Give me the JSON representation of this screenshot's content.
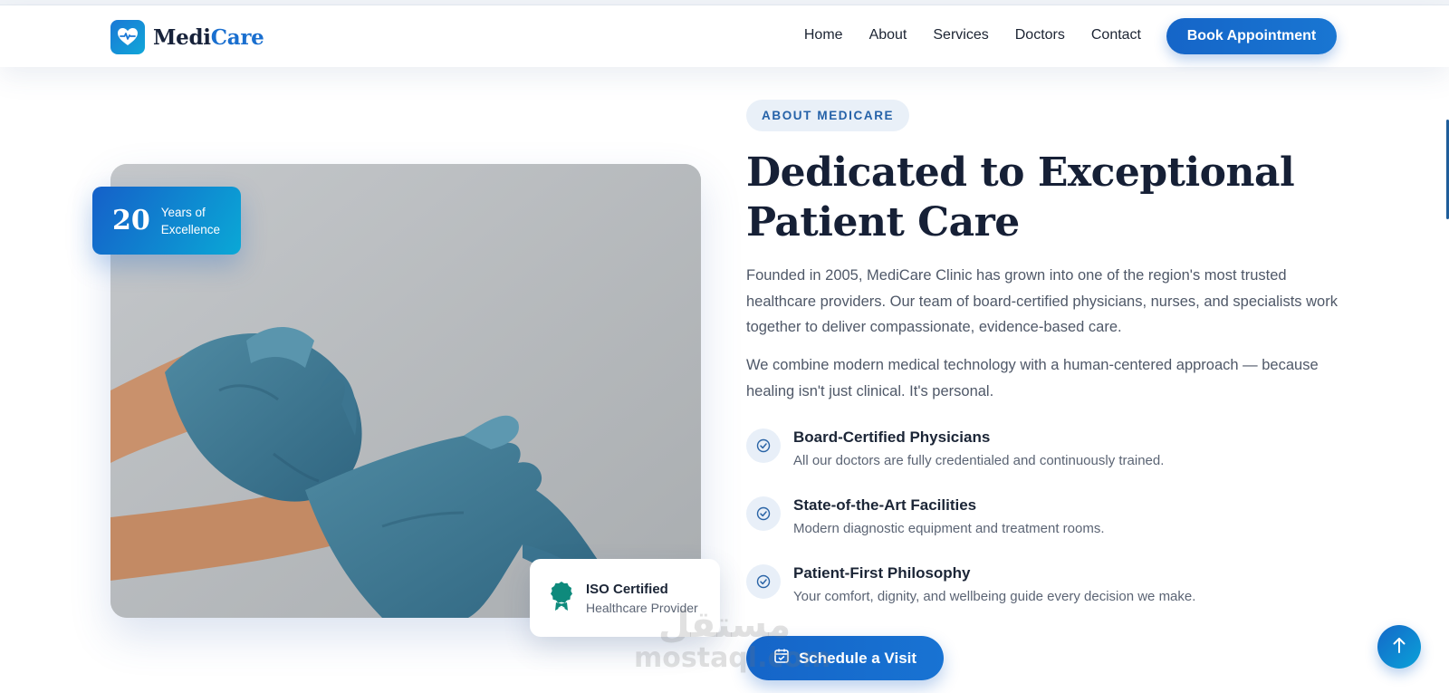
{
  "brand": {
    "name_part1": "Medi",
    "name_part2": "Care",
    "logo_icon": "heart-pulse-icon",
    "accent_color": "#1a6fcf"
  },
  "nav": {
    "items": [
      "Home",
      "About",
      "Services",
      "Doctors",
      "Contact"
    ],
    "cta_label": "Book Appointment"
  },
  "about": {
    "eyebrow": "ABOUT MEDICARE",
    "heading": "Dedicated to Exceptional Patient Care",
    "paragraph_1": "Founded in 2005, MediCare Clinic has grown into one of the region's most trusted healthcare providers. Our team of board-certified physicians, nurses, and specialists work together to deliver compassionate, evidence-based care.",
    "paragraph_2": "We combine modern medical technology with a human-centered approach — because healing isn't just clinical. It's personal.",
    "features": [
      {
        "title": "Board-Certified Physicians",
        "desc": "All our doctors are fully credentialed and continuously trained.",
        "icon": "check-circle-icon"
      },
      {
        "title": "State-of-the-Art Facilities",
        "desc": "Modern diagnostic equipment and treatment rooms.",
        "icon": "check-circle-icon"
      },
      {
        "title": "Patient-First Philosophy",
        "desc": "Your comfort, dignity, and wellbeing guide every decision we make.",
        "icon": "check-circle-icon"
      }
    ],
    "cta_label": "Schedule a Visit",
    "cta_icon": "calendar-check-icon"
  },
  "image_overlay": {
    "years_number": "20",
    "years_label": "Years of Excellence",
    "iso_title": "ISO Certified",
    "iso_subtitle": "Healthcare Provider",
    "iso_icon": "award-ribbon-icon",
    "iso_color": "#0e8a7c"
  },
  "watermark": {
    "arabic": "مستقل",
    "latin": "mostaql.com"
  },
  "scroll_top_icon": "arrow-up-icon"
}
